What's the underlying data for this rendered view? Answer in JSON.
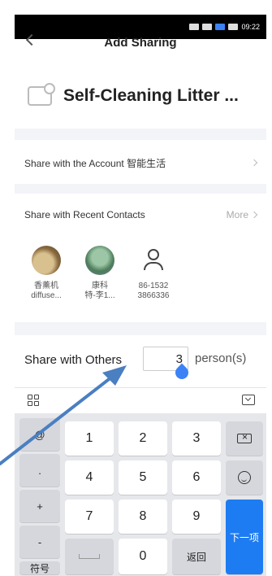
{
  "status": {
    "time": "09:22"
  },
  "header": {
    "title": "Add Sharing"
  },
  "device": {
    "name": "Self-Cleaning Litter ..."
  },
  "share_account": {
    "label": "Share with the Account 智能生活"
  },
  "recent": {
    "label": "Share with Recent Contacts",
    "more": "More"
  },
  "contacts": [
    {
      "line1": "香薰机",
      "line2": "diffuse..."
    },
    {
      "line1": "康科",
      "line2": "特-李1..."
    },
    {
      "line1": "86-1532",
      "line2": "3866336"
    }
  ],
  "others": {
    "label": "Share with Others",
    "value": "3",
    "suffix": "person(s)"
  },
  "keyboard": {
    "side": [
      "@",
      ".",
      "+",
      "-"
    ],
    "symbol": "符号",
    "back": "返回",
    "next": "下一项",
    "digits": [
      "1",
      "2",
      "3",
      "4",
      "5",
      "6",
      "7",
      "8",
      "9",
      "0"
    ]
  },
  "colors": {
    "accent": "#1e7cf2",
    "arrow": "#4a7fc1"
  }
}
